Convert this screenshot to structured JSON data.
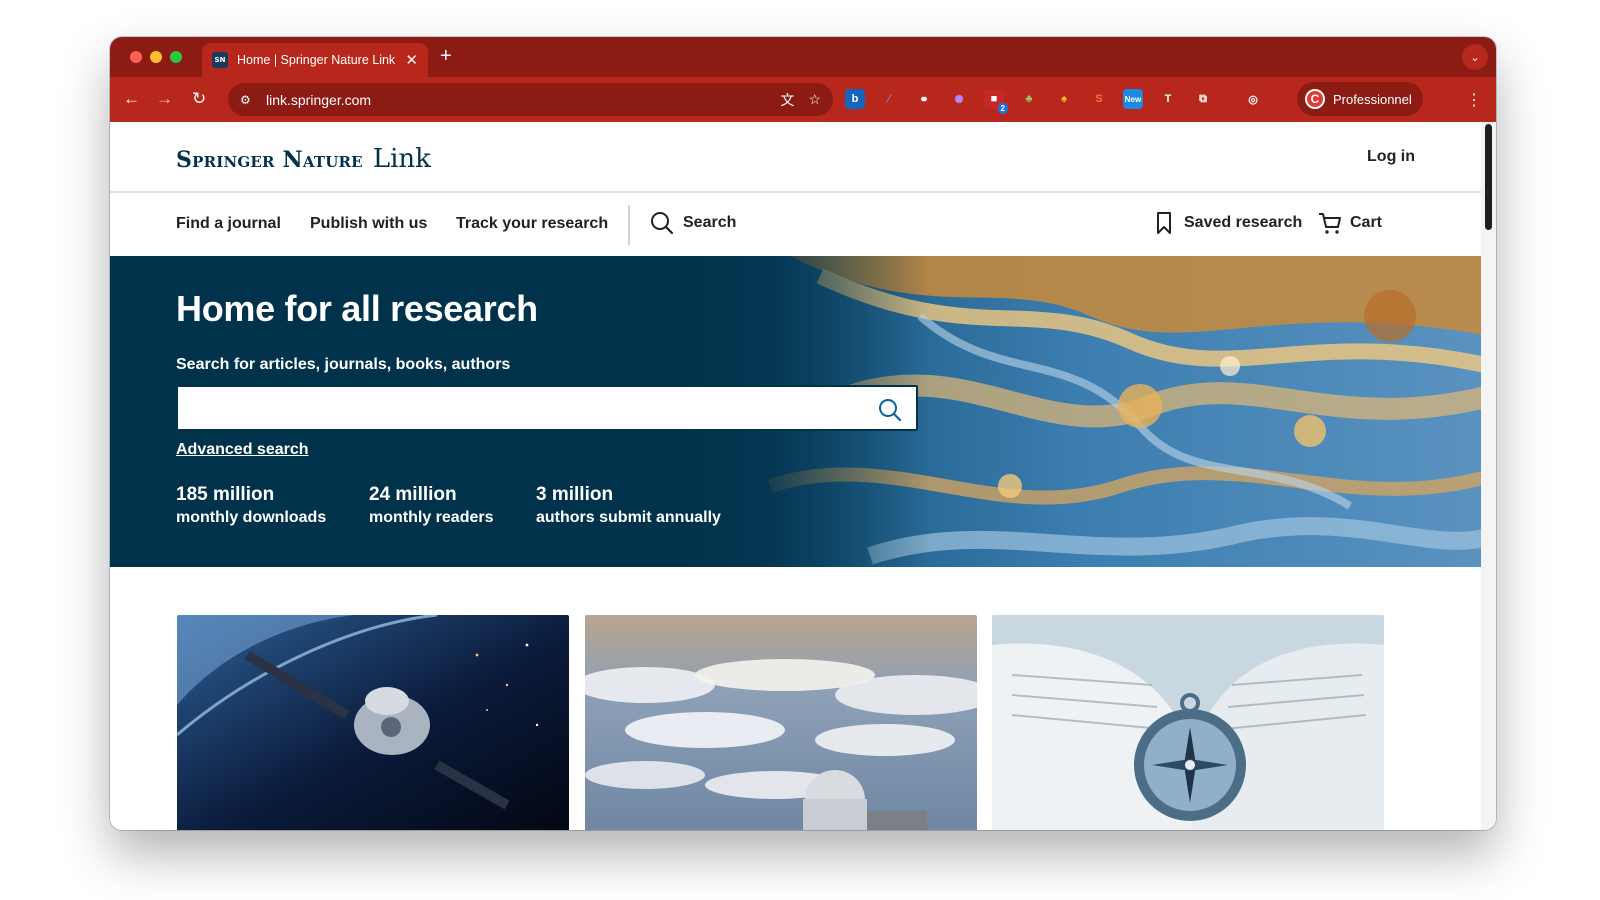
{
  "browser": {
    "tab_title": "Home | Springer Nature Link",
    "tab_favicon": "SN",
    "url": "link.springer.com",
    "profile_name": "Professionnel",
    "profile_initial": "C",
    "extension_badge": "2",
    "extension_new_label": "New",
    "accent_color": "#b8271b",
    "tabstrip_color": "#8c1b14"
  },
  "header": {
    "brand_main": "Springer Nature",
    "brand_link": "Link",
    "login": "Log in",
    "brand_color": "#01324b"
  },
  "nav": {
    "find_journal": "Find a journal",
    "publish": "Publish with us",
    "track": "Track your research",
    "search": "Search",
    "saved": "Saved research",
    "cart": "Cart"
  },
  "hero": {
    "title": "Home for all research",
    "subtitle": "Search for articles, journals, books, authors",
    "search_value": "",
    "advanced_search": "Advanced search",
    "stats": [
      {
        "number": "185 million",
        "label": "monthly downloads"
      },
      {
        "number": "24 million",
        "label": "monthly readers"
      },
      {
        "number": "3 million",
        "label": "authors submit annually"
      }
    ]
  },
  "cards": [
    {
      "image": "spacecraft-orbit-image"
    },
    {
      "image": "observatory-clouds-image"
    },
    {
      "image": "compass-book-image"
    }
  ]
}
